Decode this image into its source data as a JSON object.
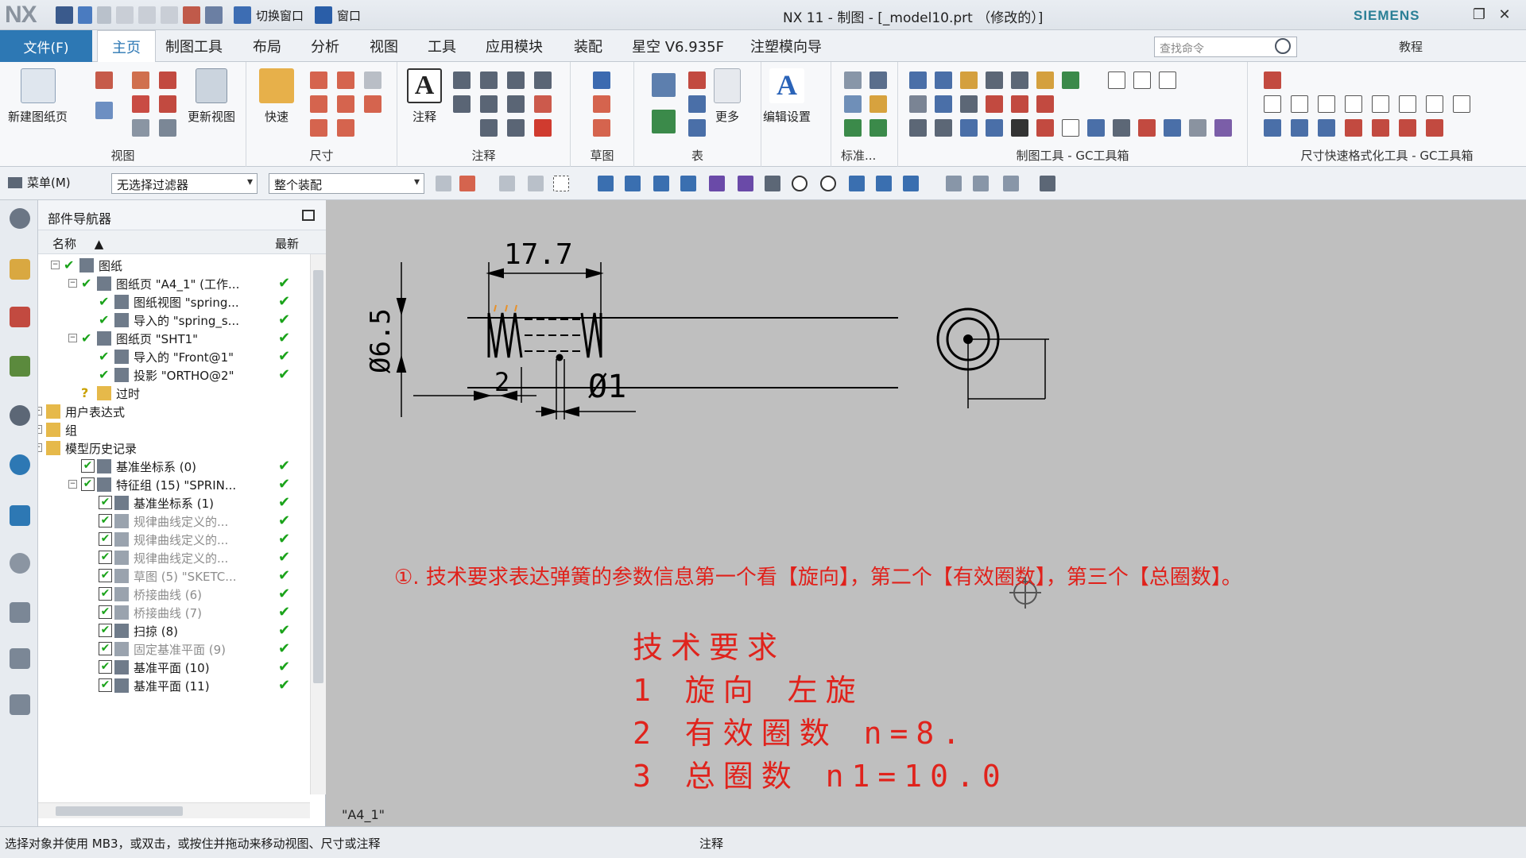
{
  "app": {
    "logo": "NX",
    "title": "NX 11 - 制图 - [_model10.prt （修改的）]",
    "brand": "SIEMENS",
    "quick_access": {
      "switch_window": "切换窗口",
      "window": "窗口"
    }
  },
  "ribbon": {
    "file_tab": "文件(F)",
    "tabs": [
      "主页",
      "制图工具",
      "布局",
      "分析",
      "视图",
      "工具",
      "应用模块",
      "装配",
      "星空 V6.935F",
      "注塑模向导"
    ],
    "search_placeholder": "查找命令",
    "tutorial": "教程",
    "groups": {
      "view": "视图",
      "dimension": "尺寸",
      "annotation": "注释",
      "sketch": "草图",
      "table": "表",
      "standard": "标准...",
      "drafting_tools": "制图工具 - GC工具箱",
      "dim_format": "尺寸快速格式化工具 - GC工具箱"
    },
    "buttons": {
      "new_sheet": "新建图纸页",
      "update_view": "更新视图",
      "rapid": "快速",
      "note": "注释",
      "more": "更多",
      "edit_settings": "编辑设置"
    }
  },
  "toolbar": {
    "menu": "菜单(M)",
    "filter": "无选择过滤器",
    "scope": "整个装配"
  },
  "navigator": {
    "title": "部件导航器",
    "col_name": "名称",
    "col_latest": "最新",
    "rows": [
      {
        "label": "图纸",
        "dim": false,
        "latest": false
      },
      {
        "label": "图纸页 \"A4_1\" (工作...",
        "dim": false,
        "latest": true
      },
      {
        "label": "图纸视图 \"spring...",
        "dim": false,
        "latest": true
      },
      {
        "label": "导入的 \"spring_s...",
        "dim": false,
        "latest": true
      },
      {
        "label": "图纸页 \"SHT1\"",
        "dim": false,
        "latest": true
      },
      {
        "label": "导入的 \"Front@1\"",
        "dim": false,
        "latest": true
      },
      {
        "label": "投影 \"ORTHO@2\"",
        "dim": false,
        "latest": true
      },
      {
        "label": "过时",
        "dim": false,
        "latest": false
      },
      {
        "label": "用户表达式",
        "dim": false,
        "latest": false
      },
      {
        "label": "组",
        "dim": false,
        "latest": false
      },
      {
        "label": "模型历史记录",
        "dim": false,
        "latest": false
      },
      {
        "label": "基准坐标系 (0)",
        "dim": false,
        "latest": true
      },
      {
        "label": "特征组 (15) \"SPRIN...",
        "dim": false,
        "latest": true
      },
      {
        "label": "基准坐标系 (1)",
        "dim": false,
        "latest": true
      },
      {
        "label": "规律曲线定义的...",
        "dim": true,
        "latest": true
      },
      {
        "label": "规律曲线定义的...",
        "dim": true,
        "latest": true
      },
      {
        "label": "规律曲线定义的...",
        "dim": true,
        "latest": true
      },
      {
        "label": "草图 (5) \"SKETC...",
        "dim": true,
        "latest": true
      },
      {
        "label": "桥接曲线 (6)",
        "dim": true,
        "latest": true
      },
      {
        "label": "桥接曲线 (7)",
        "dim": true,
        "latest": true
      },
      {
        "label": "扫掠 (8)",
        "dim": false,
        "latest": true
      },
      {
        "label": "固定基准平面 (9)",
        "dim": true,
        "latest": true
      },
      {
        "label": "基准平面 (10)",
        "dim": false,
        "latest": true
      },
      {
        "label": "基准平面 (11)",
        "dim": false,
        "latest": true
      }
    ]
  },
  "drawing": {
    "sheet_name": "\"A4_1\"",
    "dim_length": "17.7",
    "dim_diameter": "Ø6.5",
    "dim_pitch": "2",
    "dim_wire": "Ø1",
    "annotation": "①. 技术要求表达弹簧的参数信息第一个看【旋向】，第二个【有效圈数】，第三个【总圈数】。",
    "tech_title": "技术要求",
    "tech_lines": [
      "1 旋向 左旋",
      "2 有效圈数 n=8.",
      "3 总圈数 n1=10.0"
    ]
  },
  "status": {
    "left": "选择对象并使用 MB3，或双击，或按住并拖动来移动视图、尺寸或注释",
    "mid": "注释"
  }
}
